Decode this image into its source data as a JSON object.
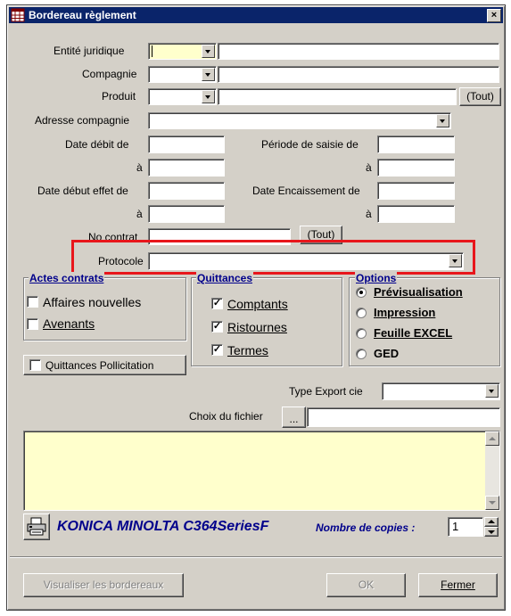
{
  "window": {
    "title": "Bordereau règlement",
    "close": "×"
  },
  "form": {
    "entite_label": "Entité juridique",
    "compagnie_label": "Compagnie",
    "produit_label": "Produit",
    "tout_produit": "(Tout)",
    "adresse_label": "Adresse compagnie",
    "date_debit_label": "Date débit de",
    "a1_label": "à",
    "periode_label": "Période de saisie de",
    "a2_label": "à",
    "date_debut_label": "Date début effet de",
    "a3_label": "à",
    "date_encaissement_label": "Date Encaissement de",
    "a4_label": "à",
    "no_contrat_label": "No contrat",
    "tout_contrat": "(Tout)",
    "protocole_label": "Protocole"
  },
  "actes": {
    "title": "Actes contrats",
    "items": [
      {
        "label": "Affaires nouvelles",
        "checked": false
      },
      {
        "label": "Avenants",
        "checked": false
      }
    ]
  },
  "quittances": {
    "title": "Quittances",
    "items": [
      {
        "label": "Comptants",
        "checked": true
      },
      {
        "label": "Ristournes",
        "checked": true
      },
      {
        "label": "Termes",
        "checked": true
      }
    ]
  },
  "options": {
    "title": "Options",
    "items": [
      {
        "label": "Prévisualisation",
        "selected": true
      },
      {
        "label": "Impression",
        "selected": false
      },
      {
        "label": "Feuille EXCEL",
        "selected": false
      },
      {
        "label": "GED",
        "selected": false
      }
    ]
  },
  "pollicitation": {
    "label": "Quittances Pollicitation",
    "checked": false
  },
  "export": {
    "type_label": "Type Export cie",
    "fichier_label": "Choix du fichier",
    "browse": "..."
  },
  "printer": {
    "name": "KONICA MINOLTA C364SeriesF",
    "copies_label": "Nombre de copies :",
    "copies": "1"
  },
  "footer": {
    "visualiser": "Visualiser les bordereaux",
    "ok": "OK",
    "fermer": "Fermer"
  },
  "colors": {
    "titlebar": "#0a246a",
    "highlight": "#e8161b",
    "memo": "#ffffcc",
    "dialog": "#d4d0c8"
  }
}
